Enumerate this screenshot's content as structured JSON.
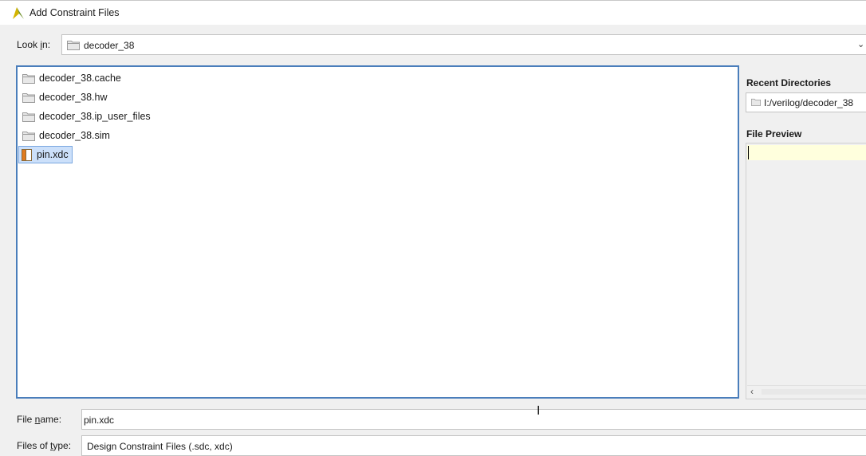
{
  "window": {
    "title": "Add Constraint Files",
    "icon": "vivado-logo-icon"
  },
  "look_in": {
    "label_pre": "Look ",
    "label_mnemonic": "i",
    "label_post": "n:",
    "value": "decoder_38"
  },
  "files": [
    {
      "name": "decoder_38.cache",
      "icon": "folder-icon"
    },
    {
      "name": "decoder_38.hw",
      "icon": "folder-icon"
    },
    {
      "name": "decoder_38.ip_user_files",
      "icon": "folder-icon"
    },
    {
      "name": "decoder_38.sim",
      "icon": "folder-icon"
    },
    {
      "name": "pin.xdc",
      "icon": "xdc-file-icon",
      "selected": true
    }
  ],
  "recent": {
    "title": "Recent Directories",
    "value": "I:/verilog/decoder_38"
  },
  "preview": {
    "title": "File Preview"
  },
  "file_name": {
    "label_pre": "File ",
    "label_mnemonic": "n",
    "label_post": "ame:",
    "value": "pin.xdc"
  },
  "file_type": {
    "label_pre": "Files of ",
    "label_mnemonic": "t",
    "label_post": "ype:",
    "value": "Design Constraint Files (.sdc, xdc)"
  },
  "colors": {
    "selection_bg": "#cce0fa",
    "list_border": "#4a7ebb",
    "preview_highlight": "#ffffdd"
  }
}
